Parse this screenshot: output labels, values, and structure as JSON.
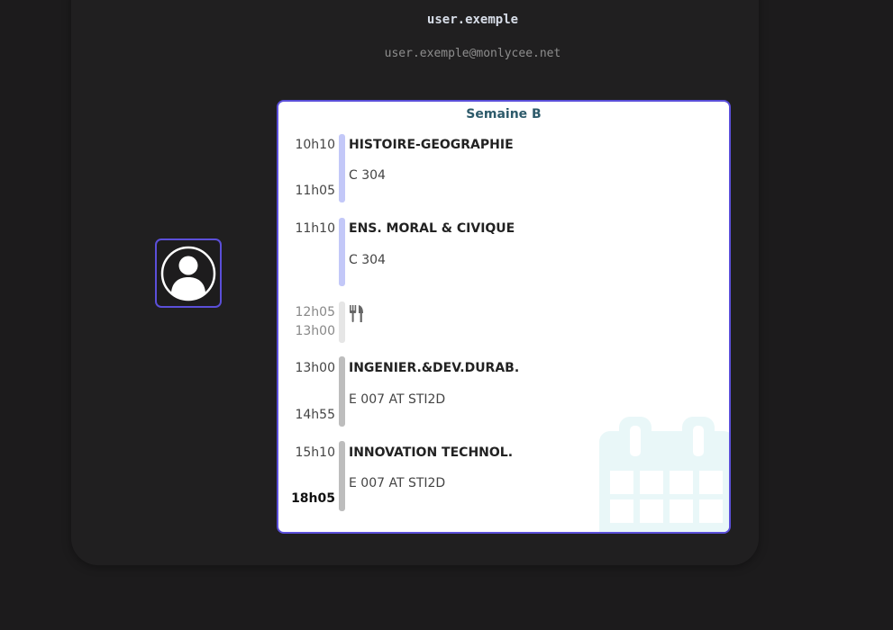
{
  "profile": {
    "username": "user.exemple",
    "email": "user.exemple@monlycee.net",
    "avatar_icon": "user-circle-icon"
  },
  "schedule": {
    "week_label": "Semaine B",
    "accent_color": "#5b4fd9",
    "lessons": [
      {
        "start": "10h10",
        "end": "11h05",
        "subject": "HISTOIRE-GEOGRAPHIE",
        "room": "C 304",
        "bar_color": "#c3c8f8"
      },
      {
        "start": "11h10",
        "end": "",
        "subject": "ENS. MORAL & CIVIQUE",
        "room": "C 304",
        "bar_color": "#c3c8f8"
      },
      {
        "start": "12h05",
        "end": "13h00",
        "icon": "fork-knife-icon",
        "bar_color": "#e6e6e6"
      },
      {
        "start": "13h00",
        "end": "14h55",
        "subject": "INGENIER.&DEV.DURAB.",
        "room": "E 007 AT STI2D",
        "bar_color": "#bdbdbd"
      },
      {
        "start": "15h10",
        "end": "18h05",
        "subject": "INNOVATION TECHNOL.",
        "room": "E 007 AT STI2D",
        "bar_color": "#bdbdbd"
      }
    ]
  }
}
